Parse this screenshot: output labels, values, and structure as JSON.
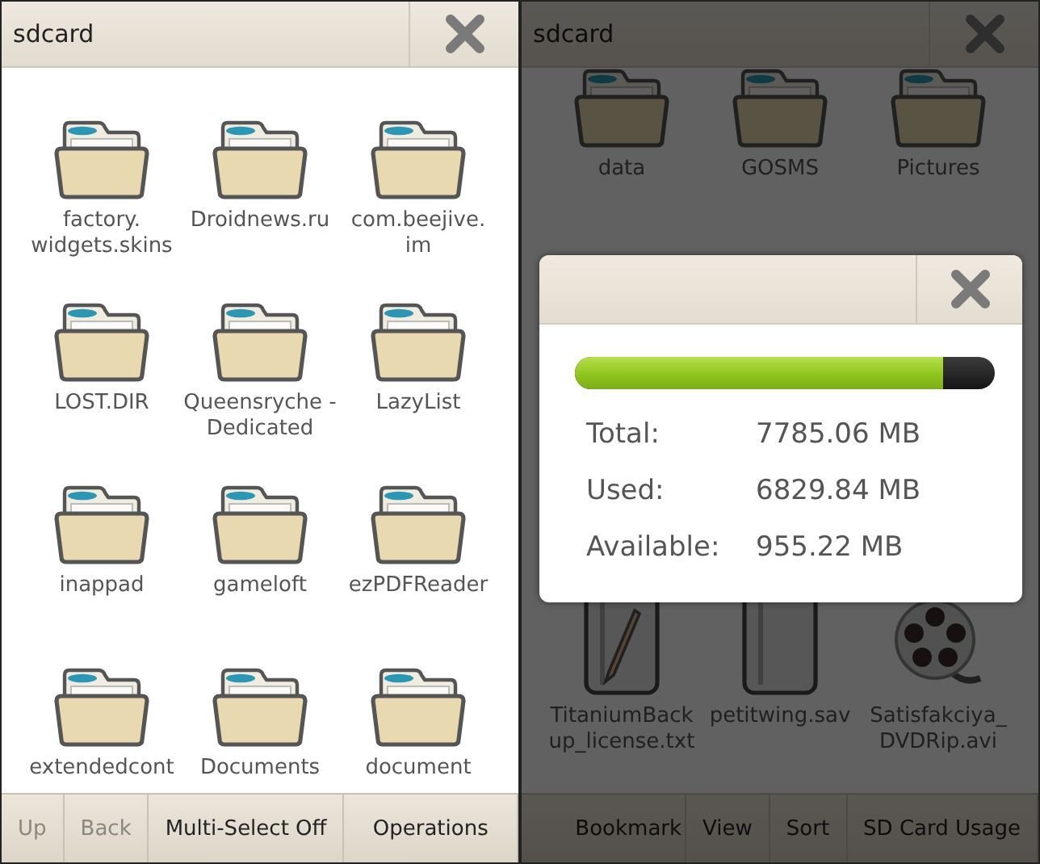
{
  "screens": [
    {
      "title": "sdcard",
      "items": [
        {
          "name": "factory.\nwidgets.skins",
          "kind": "folder"
        },
        {
          "name": "Droidnews.ru",
          "kind": "folder"
        },
        {
          "name": "com.beejive.\nim",
          "kind": "folder"
        },
        {
          "name": "LOST.DIR",
          "kind": "folder"
        },
        {
          "name": "Queensryche - Dedicated",
          "kind": "folder"
        },
        {
          "name": "LazyList",
          "kind": "folder"
        },
        {
          "name": "inappad",
          "kind": "folder"
        },
        {
          "name": "gameloft",
          "kind": "folder"
        },
        {
          "name": "ezPDFReader",
          "kind": "folder"
        },
        {
          "name": "extendedcont",
          "kind": "folder"
        },
        {
          "name": "Documents",
          "kind": "folder"
        },
        {
          "name": "document",
          "kind": "folder"
        }
      ],
      "toolbar": [
        {
          "label": "Up",
          "disabled": true
        },
        {
          "label": "Back",
          "disabled": true
        },
        {
          "label": "Multi-Select Off",
          "disabled": false
        },
        {
          "label": "Operations",
          "disabled": false
        }
      ]
    },
    {
      "title": "sdcard",
      "items": [
        {
          "name": "data",
          "kind": "folder"
        },
        {
          "name": "GOSMS",
          "kind": "folder"
        },
        {
          "name": "Pictures",
          "kind": "folder"
        },
        {
          "name": "TitaniumBack\nup_license.txt",
          "kind": "text"
        },
        {
          "name": "petitwing.sav",
          "kind": "file"
        },
        {
          "name": "Satisfakciya_\nDVDRip.avi",
          "kind": "video"
        }
      ],
      "toolbar": [
        {
          "label": "Bookmark",
          "disabled": false
        },
        {
          "label": "View",
          "disabled": false
        },
        {
          "label": "Sort",
          "disabled": false
        },
        {
          "label": "SD Card Usage",
          "disabled": false
        }
      ],
      "usage_dialog": {
        "level": 0.877,
        "rows": [
          {
            "label": "Total:",
            "value": "7785.06 MB"
          },
          {
            "label": "Used:",
            "value": "6829.84 MB"
          },
          {
            "label": "Available:",
            "value": "955.22 MB"
          }
        ]
      }
    }
  ]
}
